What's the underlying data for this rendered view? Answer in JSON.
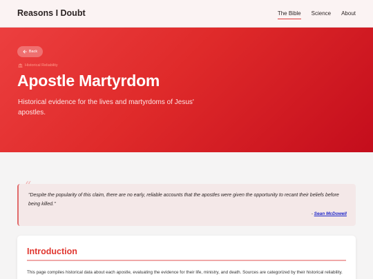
{
  "nav": {
    "brand": "Reasons I Doubt",
    "links": [
      {
        "label": "The Bible",
        "active": true
      },
      {
        "label": "Science",
        "active": false
      },
      {
        "label": "About",
        "active": false
      }
    ],
    "accent_color": "#e03a3a"
  },
  "hero": {
    "back_label": "Back",
    "back_icon": "arrow-left-icon",
    "breadcrumb": "Historical Reliability",
    "breadcrumb_icon": "building-icon",
    "title": "Apostle Martyrdom",
    "subtitle": "Historical evidence for the lives and martyrdoms of Jesus' apostles.",
    "gradient_start": "#ec3f3f",
    "gradient_end": "#c40d1c"
  },
  "quote": {
    "text": "\"Despite the popularity of this claim, there are no early, reliable accounts that the apostles were given the opportunity to recant their beliefs before being killed.\"",
    "attribution_prefix": "- ",
    "author": "Sean McDowell"
  },
  "intro": {
    "title": "Introduction",
    "text": "This page compiles historical data about each apostle, evaluating the evidence for their life, ministry, and death. Sources are categorized by their historical reliability."
  }
}
